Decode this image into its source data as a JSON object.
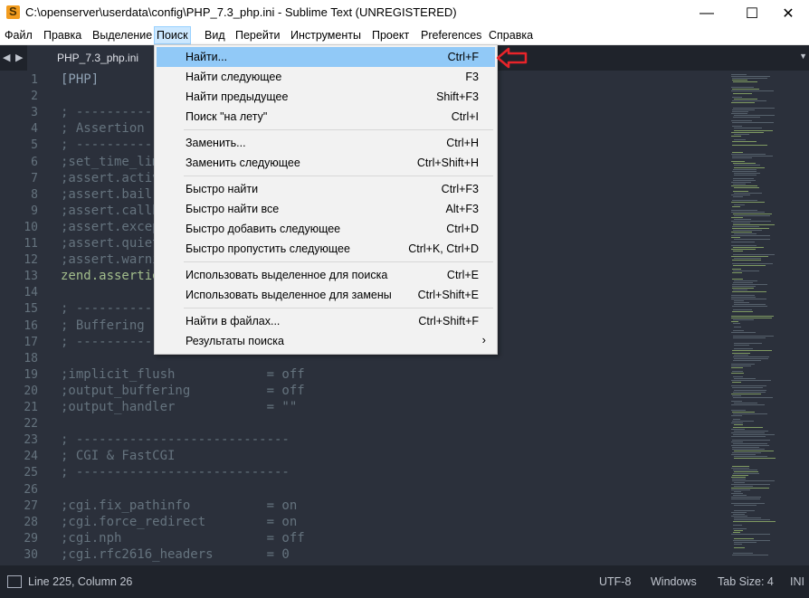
{
  "window": {
    "title": "C:\\openserver\\userdata\\config\\PHP_7.3_php.ini - Sublime Text (UNREGISTERED)",
    "controls": {
      "minimize": "—",
      "maximize": "☐",
      "close": "✕"
    }
  },
  "menubar": {
    "items": [
      "Файл",
      "Правка",
      "Выделение",
      "Поиск",
      "Вид",
      "Перейти",
      "Инструменты",
      "Проект",
      "Preferences",
      "Справка"
    ],
    "active": "Поиск"
  },
  "tabs": {
    "nav_left": "◀",
    "nav_right": "▶",
    "active_tab": "PHP_7.3_php.ini",
    "dropdown": "▼"
  },
  "editor": {
    "line_numbers": [
      "1",
      "2",
      "3",
      "4",
      "5",
      "6",
      "7",
      "8",
      "9",
      "10",
      "11",
      "12",
      "13",
      "14",
      "15",
      "16",
      "17",
      "18",
      "19",
      "20",
      "21",
      "22",
      "23",
      "24",
      "25",
      "26",
      "27",
      "28",
      "29",
      "30"
    ],
    "lines": [
      {
        "text": "[PHP]",
        "style": "sec"
      },
      {
        "text": "",
        "style": ""
      },
      {
        "text": "; ----------",
        "style": ""
      },
      {
        "text": "; Assertion",
        "style": ""
      },
      {
        "text": "; ----------",
        "style": ""
      },
      {
        "text": ";set_time_lim",
        "style": ""
      },
      {
        "text": ";assert.activ",
        "style": ""
      },
      {
        "text": ";assert.bail",
        "style": ""
      },
      {
        "text": ";assert.callb",
        "style": ""
      },
      {
        "text": ";assert.excep",
        "style": ""
      },
      {
        "text": ";assert.quiet",
        "style": ""
      },
      {
        "text": ";assert.warni",
        "style": ""
      },
      {
        "text": "zend.assertio",
        "style": "key"
      },
      {
        "text": "",
        "style": ""
      },
      {
        "text": "; ----------",
        "style": ""
      },
      {
        "text": "; Buffering",
        "style": ""
      },
      {
        "text": "; ----------",
        "style": ""
      },
      {
        "text": "",
        "style": ""
      },
      {
        "text": ";implicit_flush            = off",
        "style": ""
      },
      {
        "text": ";output_buffering          = off",
        "style": ""
      },
      {
        "text": ";output_handler            = \"\"",
        "style": ""
      },
      {
        "text": "",
        "style": ""
      },
      {
        "text": "; ----------------------------",
        "style": ""
      },
      {
        "text": "; CGI & FastCGI",
        "style": ""
      },
      {
        "text": "; ----------------------------",
        "style": ""
      },
      {
        "text": "",
        "style": ""
      },
      {
        "text": ";cgi.fix_pathinfo          = on",
        "style": ""
      },
      {
        "text": ";cgi.force_redirect        = on",
        "style": ""
      },
      {
        "text": ";cgi.nph                   = off",
        "style": ""
      },
      {
        "text": ";cgi.rfc2616_headers       = 0",
        "style": ""
      }
    ]
  },
  "search_menu": {
    "groups": [
      [
        {
          "label": "Найти...",
          "shortcut": "Ctrl+F",
          "highlighted": true
        },
        {
          "label": "Найти следующее",
          "shortcut": "F3"
        },
        {
          "label": "Найти предыдущее",
          "shortcut": "Shift+F3"
        },
        {
          "label": "Поиск \"на лету\"",
          "shortcut": "Ctrl+I"
        }
      ],
      [
        {
          "label": "Заменить...",
          "shortcut": "Ctrl+H"
        },
        {
          "label": "Заменить следующее",
          "shortcut": "Ctrl+Shift+H"
        }
      ],
      [
        {
          "label": "Быстро найти",
          "shortcut": "Ctrl+F3"
        },
        {
          "label": "Быстро найти все",
          "shortcut": "Alt+F3"
        },
        {
          "label": "Быстро добавить следующее",
          "shortcut": "Ctrl+D"
        },
        {
          "label": "Быстро пропустить следующее",
          "shortcut": "Ctrl+K, Ctrl+D"
        }
      ],
      [
        {
          "label": "Использовать выделенное для поиска",
          "shortcut": "Ctrl+E"
        },
        {
          "label": "Использовать выделенное для замены",
          "shortcut": "Ctrl+Shift+E"
        }
      ],
      [
        {
          "label": "Найти в файлах...",
          "shortcut": "Ctrl+Shift+F"
        },
        {
          "label": "Результаты поиска",
          "shortcut": "",
          "submenu": "›"
        }
      ]
    ]
  },
  "statusbar": {
    "position": "Line 225, Column 26",
    "encoding": "UTF-8",
    "line_endings": "Windows",
    "tab_size": "Tab Size: 4",
    "syntax": "INI"
  },
  "colors": {
    "editor_bg": "#2b303b",
    "comment": "#65737e",
    "key": "#a3be8c",
    "section": "#8fa1b3",
    "highlight": "#91c9f7",
    "annotation_arrow": "#e8242a"
  }
}
